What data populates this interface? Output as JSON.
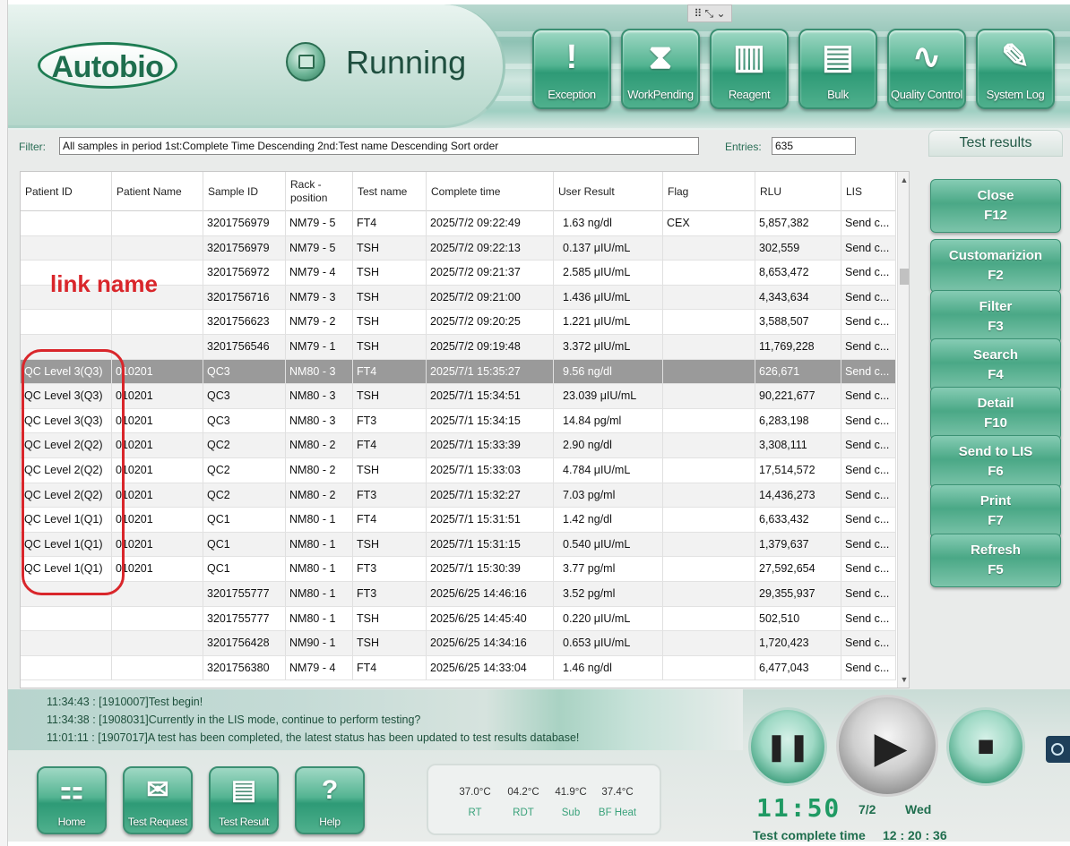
{
  "window": {
    "handle_glyph": "⠿ ⤡ ⌄"
  },
  "header": {
    "logo_text": "Autobio",
    "status_title": "Running",
    "nav": [
      {
        "label": "Exception",
        "icon": "exclamation-icon",
        "glyph": "!"
      },
      {
        "label": "WorkPending",
        "icon": "hourglass-icon",
        "glyph": "⧗"
      },
      {
        "label": "Reagent",
        "icon": "reagent-rack-icon",
        "glyph": "▥"
      },
      {
        "label": "Bulk",
        "icon": "bulk-bottles-icon",
        "glyph": "▤"
      },
      {
        "label": "Quality Control",
        "icon": "qc-chart-icon",
        "glyph": "∿"
      },
      {
        "label": "System Log",
        "icon": "log-document-icon",
        "glyph": "✎"
      }
    ]
  },
  "filter": {
    "label": "Filter:",
    "value": "All samples in period   1st:Complete Time Descending 2nd:Test name Descending Sort order",
    "entries_label": "Entries:",
    "entries_value": "635"
  },
  "tab_label": "Test results",
  "table": {
    "columns": [
      "Patient ID",
      "Patient Name",
      "Sample ID",
      "Rack -\nposition",
      "Test name",
      "Complete time",
      "User Result",
      "Flag",
      "RLU",
      "LIS"
    ],
    "rows": [
      [
        "",
        "",
        "3201756979",
        "NM79 - 5",
        "FT4",
        "2025/7/2 09:22:49",
        "1.63 ng/dl",
        "CEX",
        "5,857,382",
        "Send c..."
      ],
      [
        "",
        "",
        "3201756979",
        "NM79 - 5",
        "TSH",
        "2025/7/2 09:22:13",
        "0.137 μIU/mL",
        "",
        "302,559",
        "Send c..."
      ],
      [
        "",
        "",
        "3201756972",
        "NM79 - 4",
        "TSH",
        "2025/7/2 09:21:37",
        "2.585 μIU/mL",
        "",
        "8,653,472",
        "Send c..."
      ],
      [
        "",
        "",
        "3201756716",
        "NM79 - 3",
        "TSH",
        "2025/7/2 09:21:00",
        "1.436 μIU/mL",
        "",
        "4,343,634",
        "Send c..."
      ],
      [
        "",
        "",
        "3201756623",
        "NM79 - 2",
        "TSH",
        "2025/7/2 09:20:25",
        "1.221 μIU/mL",
        "",
        "3,588,507",
        "Send c..."
      ],
      [
        "",
        "",
        "3201756546",
        "NM79 - 1",
        "TSH",
        "2025/7/2 09:19:48",
        "3.372 μIU/mL",
        "",
        "11,769,228",
        "Send c..."
      ],
      [
        "QC Level 3(Q3)",
        "010201",
        "QC3",
        "NM80 - 3",
        "FT4",
        "2025/7/1 15:35:27",
        "9.56 ng/dl",
        "",
        "626,671",
        "Send c..."
      ],
      [
        "QC Level 3(Q3)",
        "010201",
        "QC3",
        "NM80 - 3",
        "TSH",
        "2025/7/1 15:34:51",
        "23.039 μIU/mL",
        "",
        "90,221,677",
        "Send c..."
      ],
      [
        "QC Level 3(Q3)",
        "010201",
        "QC3",
        "NM80 - 3",
        "FT3",
        "2025/7/1 15:34:15",
        "14.84 pg/ml",
        "",
        "6,283,198",
        "Send c..."
      ],
      [
        "QC Level 2(Q2)",
        "010201",
        "QC2",
        "NM80 - 2",
        "FT4",
        "2025/7/1 15:33:39",
        "2.90 ng/dl",
        "",
        "3,308,111",
        "Send c..."
      ],
      [
        "QC Level 2(Q2)",
        "010201",
        "QC2",
        "NM80 - 2",
        "TSH",
        "2025/7/1 15:33:03",
        "4.784 μIU/mL",
        "",
        "17,514,572",
        "Send c..."
      ],
      [
        "QC Level 2(Q2)",
        "010201",
        "QC2",
        "NM80 - 2",
        "FT3",
        "2025/7/1 15:32:27",
        "7.03 pg/ml",
        "",
        "14,436,273",
        "Send c..."
      ],
      [
        "QC Level 1(Q1)",
        "010201",
        "QC1",
        "NM80 - 1",
        "FT4",
        "2025/7/1 15:31:51",
        "1.42 ng/dl",
        "",
        "6,633,432",
        "Send c..."
      ],
      [
        "QC Level 1(Q1)",
        "010201",
        "QC1",
        "NM80 - 1",
        "TSH",
        "2025/7/1 15:31:15",
        "0.540 μIU/mL",
        "",
        "1,379,637",
        "Send c..."
      ],
      [
        "QC Level 1(Q1)",
        "010201",
        "QC1",
        "NM80 - 1",
        "FT3",
        "2025/7/1 15:30:39",
        "3.77 pg/ml",
        "",
        "27,592,654",
        "Send c..."
      ],
      [
        "",
        "",
        "3201755777",
        "NM80 - 1",
        "FT3",
        "2025/6/25 14:46:16",
        "3.52 pg/ml",
        "",
        "29,355,937",
        "Send c..."
      ],
      [
        "",
        "",
        "3201755777",
        "NM80 - 1",
        "TSH",
        "2025/6/25 14:45:40",
        "0.220 μIU/mL",
        "",
        "502,510",
        "Send c..."
      ],
      [
        "",
        "",
        "3201756428",
        "NM90 - 1",
        "TSH",
        "2025/6/25 14:34:16",
        "0.653 μIU/mL",
        "",
        "1,720,423",
        "Send c..."
      ],
      [
        "",
        "",
        "3201756380",
        "NM79 - 4",
        "FT4",
        "2025/6/25 14:33:04",
        "1.46 ng/dl",
        "",
        "6,477,043",
        "Send c..."
      ]
    ],
    "selected_row": 6
  },
  "annotation": {
    "text": "link name",
    "color": "#d9262b"
  },
  "side_buttons": [
    {
      "label": "Close",
      "key": "F12"
    },
    {
      "label": "Customarizion",
      "key": "F2"
    },
    {
      "label": "Filter",
      "key": "F3"
    },
    {
      "label": "Search",
      "key": "F4"
    },
    {
      "label": "Detail",
      "key": "F10"
    },
    {
      "label": "Send to LIS",
      "key": "F6"
    },
    {
      "label": "Print",
      "key": "F7"
    },
    {
      "label": "Refresh",
      "key": "F5"
    }
  ],
  "log": [
    "11:34:43 : [1910007]Test begin!",
    "11:34:38 : [1908031]Currently in the LIS mode, continue to perform testing?",
    "11:01:11 : [1907017]A test has been completed, the latest status has been updated to test results database!"
  ],
  "bottom_nav": [
    {
      "label": "Home",
      "icon": "home-icon",
      "glyph": "⚏"
    },
    {
      "label": "Test Request",
      "icon": "test-request-icon",
      "glyph": "✉"
    },
    {
      "label": "Test Result",
      "icon": "test-result-icon",
      "glyph": "▤"
    },
    {
      "label": "Help",
      "icon": "help-icon",
      "glyph": "?"
    }
  ],
  "temperatures": [
    {
      "value": "37.0°C",
      "label": "RT"
    },
    {
      "value": "04.2°C",
      "label": "RDT"
    },
    {
      "value": "41.9°C",
      "label": "Sub"
    },
    {
      "value": "37.4°C",
      "label": "BF Heat"
    }
  ],
  "controls": {
    "pause_glyph": "❚❚",
    "play_glyph": "▶",
    "stop_glyph": "■"
  },
  "clock": {
    "time": "11:50",
    "date": "7/2",
    "weekday": "Wed"
  },
  "test_complete": {
    "label": "Test complete time",
    "value": "12 : 20 : 36"
  },
  "colors": {
    "accent": "#2e9a76",
    "brand": "#1f6e4e",
    "annotation": "#d9262b",
    "selected_row": "#9a9a9a"
  }
}
